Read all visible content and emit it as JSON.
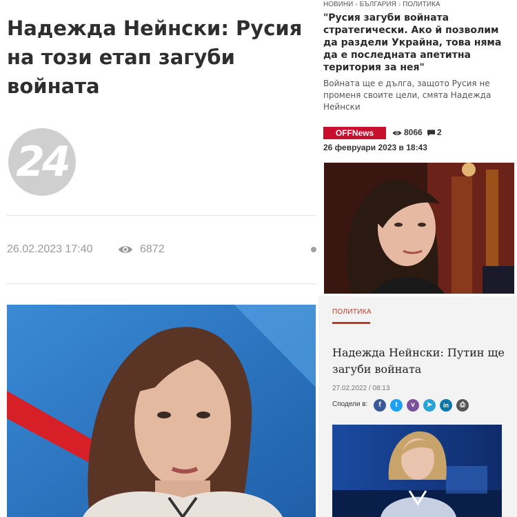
{
  "left_article": {
    "title": "Надежда Нейнски: Русия на този етап загуби войната",
    "logo_text": "24",
    "date": "26.02.2023 17:40",
    "views": "6872"
  },
  "right_top_article": {
    "breadcrumbs": [
      "НОВИНИ",
      "БЪЛГАРИЯ",
      "ПОЛИТИКА"
    ],
    "title": "\"Русия загуби войната стратегически. Ако й позволим да раздели Украйна, това няма да е последната апетитна територия за нея\"",
    "subtitle": "Войната ще е дълга, защото Русия не променя своите цели, смята Надежда Нейнски",
    "source_badge": "OFFNews",
    "views": "8066",
    "comments": "2",
    "date": "26 февруари 2023 в 18:43"
  },
  "right_bottom_article": {
    "category": "ПОЛИТИКА",
    "title": "Надежда Нейнски: Путин ще загуби войната",
    "date": "27.02.2022 / 08:13",
    "share_label": "Сподели в:",
    "share_buttons": [
      {
        "icon": "facebook-icon",
        "glyph": "f",
        "color": "#3b5998"
      },
      {
        "icon": "twitter-icon",
        "glyph": "t",
        "color": "#1da1f2"
      },
      {
        "icon": "viber-icon",
        "glyph": "v",
        "color": "#7b519d"
      },
      {
        "icon": "telegram-icon",
        "glyph": "➤",
        "color": "#2aa3d8"
      },
      {
        "icon": "linkedin-icon",
        "glyph": "in",
        "color": "#0e76a8"
      },
      {
        "icon": "print-icon",
        "glyph": "⎙",
        "color": "#555555"
      }
    ]
  },
  "colors": {
    "offnews_red": "#c8102e",
    "category_red": "#c0392b",
    "title_dark": "#2e2e2e",
    "meta_gray": "#9a9a9a"
  }
}
